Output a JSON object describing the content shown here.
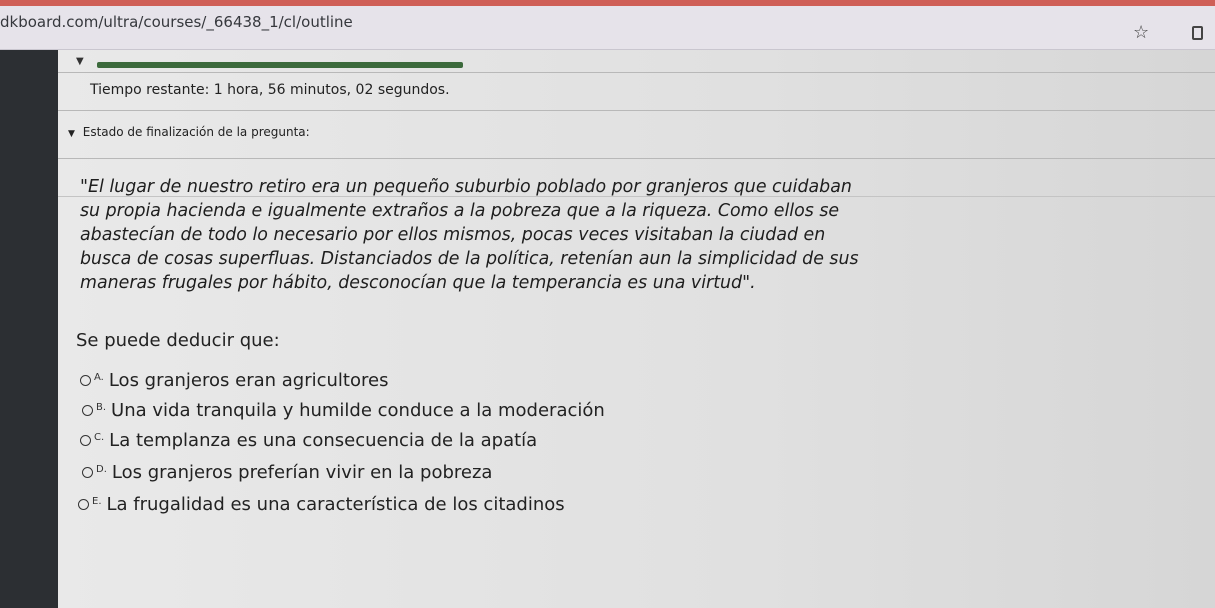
{
  "browser": {
    "url": "dkboard.com/ultra/courses/_66438_1/cl/outline",
    "bookmark_icon": "star-icon",
    "tab_icon": "tab-icon"
  },
  "exam": {
    "timer": "Tiempo restante: 1 hora, 56 minutos, 02 segundos.",
    "status_label": "Estado de finalización de la pregunta:",
    "passage": "\"El lugar de nuestro retiro era un pequeño suburbio poblado por granjeros que cuidaban\nsu propia hacienda e igualmente extraños a la pobreza que a la riqueza. Como ellos se\nabastecían de todo lo necesario por ellos mismos, pocas veces visitaban la ciudad en\nbusca de cosas superfluas. Distanciados de la política, retenían aun la simplicidad de sus\nmaneras frugales por hábito, desconocían que la temperancia es una virtud\".",
    "question": "Se puede deducir que:",
    "options": [
      {
        "letter": "A.",
        "text": "Los granjeros eran agricultores"
      },
      {
        "letter": "B.",
        "text": "Una vida tranquila y humilde conduce a la moderación"
      },
      {
        "letter": "C.",
        "text": "La templanza es una consecuencia de la apatía"
      },
      {
        "letter": "D.",
        "text": "Los granjeros preferían vivir en la pobreza"
      },
      {
        "letter": "E.",
        "text": "La frugalidad es una característica de los citadinos"
      }
    ]
  },
  "colors": {
    "accent_green": "#3c6a3c",
    "rail": "#2c2f33",
    "top_strip": "#cf5f57"
  }
}
